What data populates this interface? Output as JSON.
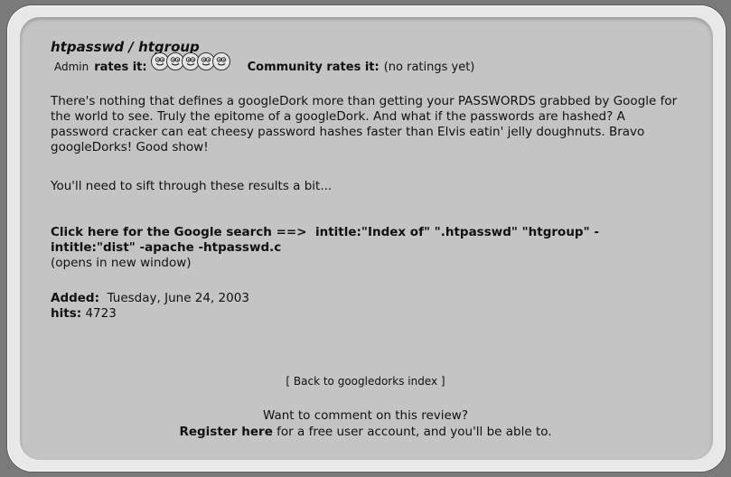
{
  "title": "htpasswd / htgroup",
  "rating": {
    "admin_label": "Admin",
    "rates_it_label": "rates it:",
    "admin_score": 5,
    "icon": "googledork-face-icon",
    "community_label": "Community rates it:",
    "community_value": "(no ratings yet)"
  },
  "description": "There's nothing that defines a googleDork more than getting your PASSWORDS grabbed by Google for the world to see. Truly the epitome of a googleDork. And what if the passwords are hashed? A password cracker can eat cheesy password hashes faster than Elvis eatin' jelly doughnuts. Bravo googleDorks! Good show!",
  "sift_note": "You'll need to sift through these results a bit...",
  "search": {
    "link_label": "Click here for the Google search ==>",
    "query": "intitle:\"Index of\" \".htpasswd\" \"htgroup\" -intitle:\"dist\" -apache -htpasswd.c",
    "new_window_note": "(opens in new window)"
  },
  "meta": {
    "added_label": "Added:",
    "added_value": "Tuesday, June 24, 2003",
    "hits_label": "hits:",
    "hits_value": "4723"
  },
  "back_link": "[ Back to googledorks index ]",
  "comment": {
    "prompt": "Want to comment on this review?",
    "register_link": "Register here",
    "register_suffix": "for a free user account, and you'll be able to."
  },
  "colors": {
    "background": "#7a7a7a",
    "card": "#c4c4c4",
    "frame": "#e8e8e8"
  }
}
